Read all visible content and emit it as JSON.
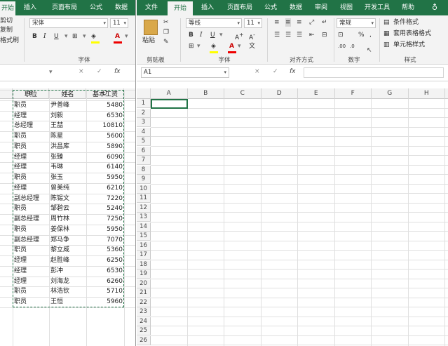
{
  "left_window": {
    "tabs": [
      "开始",
      "插入",
      "页面布局",
      "公式",
      "数据"
    ],
    "clipboard": {
      "cut": "剪切",
      "copy": "复制",
      "format_painter": "格式刷"
    },
    "font_name": "宋体",
    "font_size": "11",
    "font_group_label": "字体",
    "formula_icons": [
      "×",
      "✓",
      "fx"
    ],
    "columns": [
      "B",
      "C",
      "D"
    ],
    "headers": {
      "pos": "职位",
      "name": "姓名",
      "salary": "基本工资"
    },
    "rows": [
      {
        "pos": "职员",
        "name": "尹善峰",
        "salary": "5480"
      },
      {
        "pos": "经理",
        "name": "刘毅",
        "salary": "6530"
      },
      {
        "pos": "总经理",
        "name": "王喆",
        "salary": "10810"
      },
      {
        "pos": "职员",
        "name": "陈星",
        "salary": "5600"
      },
      {
        "pos": "职员",
        "name": "洪昌库",
        "salary": "5890"
      },
      {
        "pos": "经理",
        "name": "张臻",
        "salary": "6090"
      },
      {
        "pos": "经理",
        "name": "韦琳",
        "salary": "6140"
      },
      {
        "pos": "职员",
        "name": "张玉",
        "salary": "5950"
      },
      {
        "pos": "经理",
        "name": "曾美纯",
        "salary": "6210"
      },
      {
        "pos": "副总经理",
        "name": "陈锡文",
        "salary": "7220"
      },
      {
        "pos": "职员",
        "name": "邹碧云",
        "salary": "5240"
      },
      {
        "pos": "副总经理",
        "name": "周竹林",
        "salary": "7250"
      },
      {
        "pos": "职员",
        "name": "姜保林",
        "salary": "5950"
      },
      {
        "pos": "副总经理",
        "name": "郑马争",
        "salary": "7070"
      },
      {
        "pos": "职员",
        "name": "黎立威",
        "salary": "5360"
      },
      {
        "pos": "经理",
        "name": "赵胜峰",
        "salary": "6250"
      },
      {
        "pos": "经理",
        "name": "彭冲",
        "salary": "6530"
      },
      {
        "pos": "经理",
        "name": "刘海龙",
        "salary": "6260"
      },
      {
        "pos": "职员",
        "name": "林浩钦",
        "salary": "5710"
      },
      {
        "pos": "职员",
        "name": "王恒",
        "salary": "5960"
      }
    ]
  },
  "right_window": {
    "tabs": [
      "文件",
      "开始",
      "插入",
      "页面布局",
      "公式",
      "数据",
      "审阅",
      "视图",
      "开发工具",
      "帮助"
    ],
    "active_tab": "开始",
    "clipboard": {
      "paste": "粘贴",
      "label": "剪贴板"
    },
    "font": {
      "name": "等线",
      "size": "11",
      "label": "字体"
    },
    "alignment_label": "对齐方式",
    "number": {
      "format": "常规",
      "label": "数字"
    },
    "styles": {
      "conditional": "条件格式",
      "table": "套用表格格式",
      "cell": "单元格样式",
      "label": "样式"
    },
    "name_box": "A1",
    "formula_icons": [
      "×",
      "✓",
      "fx"
    ],
    "columns": [
      "A",
      "B",
      "C",
      "D",
      "E",
      "F",
      "G",
      "H"
    ],
    "row_numbers": [
      "1",
      "2",
      "3",
      "4",
      "5",
      "6",
      "7",
      "8",
      "9",
      "10",
      "11",
      "12",
      "13",
      "14",
      "15",
      "16",
      "17",
      "18",
      "19",
      "20",
      "21",
      "22",
      "23",
      "24",
      "25",
      "26"
    ]
  },
  "colors": {
    "accent": "#217346",
    "ribbon": "#f3f3f3"
  }
}
